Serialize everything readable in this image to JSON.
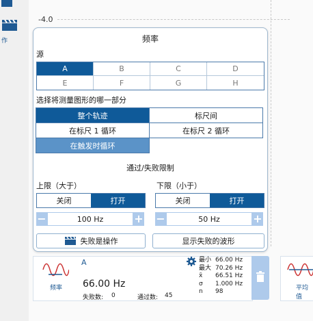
{
  "left_panel": {
    "label": "作"
  },
  "plot": {
    "axis_value": "-4.0"
  },
  "dialog": {
    "title": "频率",
    "source_label": "源",
    "sources": [
      "A",
      "B",
      "C",
      "D",
      "E",
      "F",
      "G",
      "H"
    ],
    "source_selected": "A",
    "part_label": "选择将测量图形的哪一部分",
    "parts": [
      "整个轨迹",
      "标尺间",
      "在标尺 1 循环",
      "在标尺 2 循环",
      "在触发时循环"
    ],
    "limits_title": "通过/失败限制",
    "upper": {
      "label": "上限（大于）",
      "off": "关闭",
      "on": "打开",
      "value": "100 Hz"
    },
    "lower": {
      "label": "下限（小于）",
      "off": "关闭",
      "on": "打开",
      "value": "50 Hz"
    },
    "fail_action_button": "失败是操作",
    "show_failed_button": "显示失败的波形"
  },
  "card": {
    "name": "频率",
    "source": "A",
    "value": "66.00 Hz",
    "fail_label": "失败数:",
    "fail_count": "0",
    "pass_label": "通过数:",
    "pass_count": "45",
    "stats": [
      {
        "k": "最小",
        "v": "66.00 Hz"
      },
      {
        "k": "最大",
        "v": "70.26 Hz"
      },
      {
        "k": "x̄",
        "v": "66.51 Hz"
      },
      {
        "k": "σ",
        "v": "1.000 Hz"
      },
      {
        "k": "n",
        "v": "98"
      }
    ]
  },
  "card2": {
    "name": "平均值"
  },
  "colors": {
    "accent": "#0f5a99",
    "accent_light": "#5b93c8",
    "border": "#4a79aa",
    "soft": "#aecaeb"
  }
}
